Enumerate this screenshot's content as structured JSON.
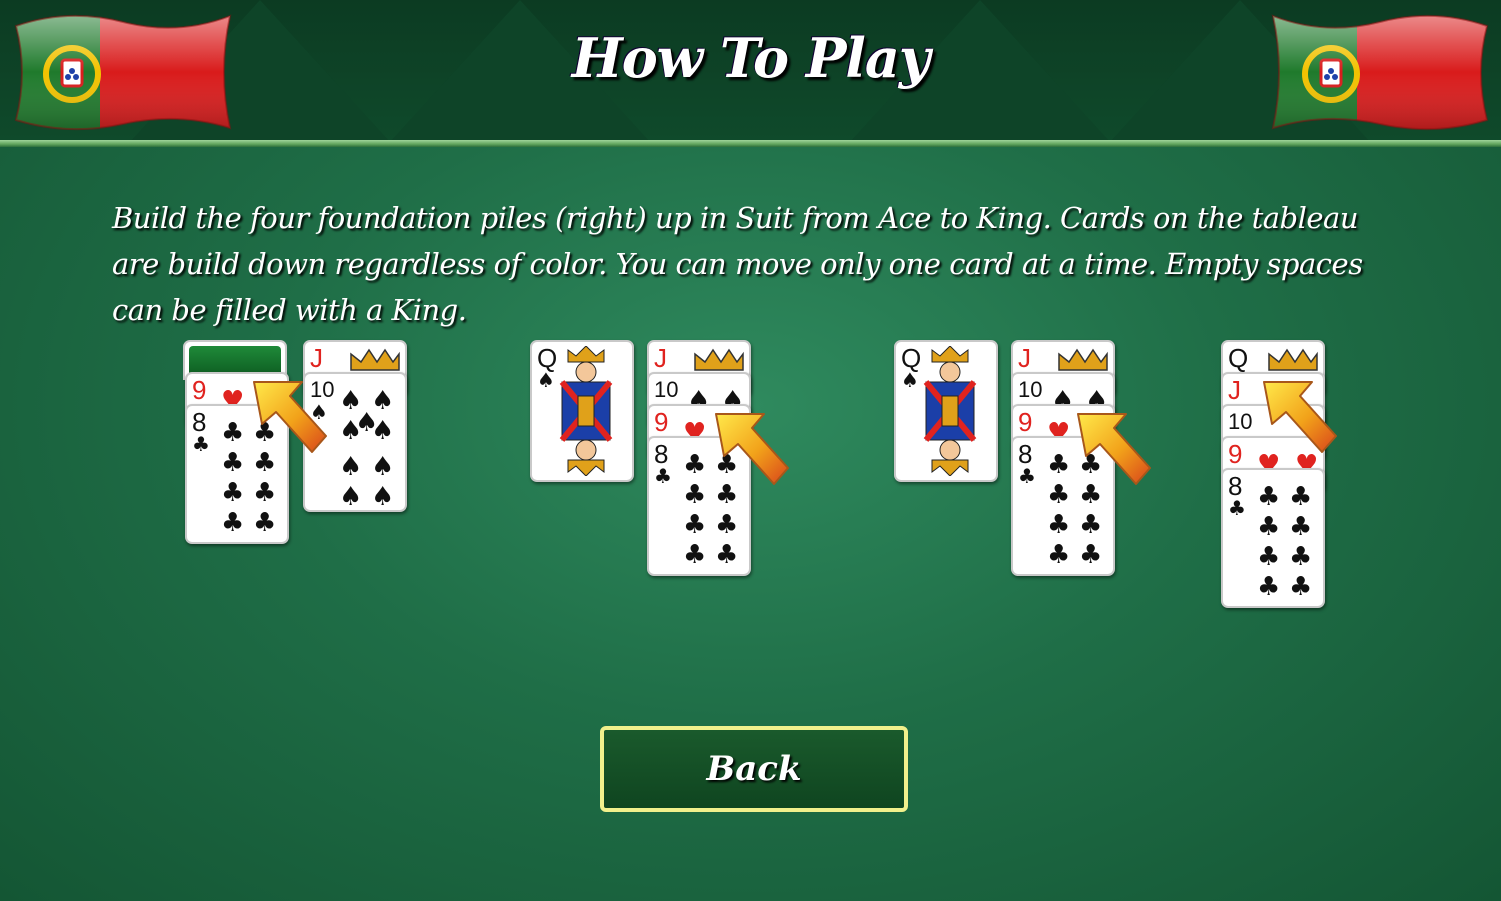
{
  "header": {
    "title": "How To Play"
  },
  "instructions": {
    "text": "Build the four foundation piles (right) up in Suit from Ace to King. Cards on the tableau are build down regardless of color. You can move only one card at a time. Empty spaces can be filled with a King."
  },
  "back_button": {
    "label": "Back"
  },
  "cards": {
    "nine": "9",
    "eight": "8",
    "jack": "J",
    "ten": "10",
    "queen": "Q"
  },
  "colors": {
    "felt": "#1f6e47",
    "button_border": "#f1f08c",
    "card_red": "#e0231f"
  },
  "icons": {
    "flags": "portugal-flag-icon",
    "arrows": "move-arrow-icon"
  }
}
